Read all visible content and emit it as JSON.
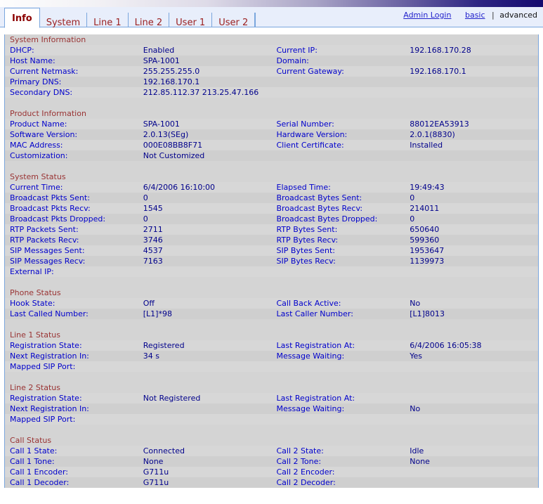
{
  "header": {
    "tabs": [
      {
        "label": "Info",
        "active": true
      },
      {
        "label": "System",
        "active": false
      },
      {
        "label": "Line 1",
        "active": false
      },
      {
        "label": "Line 2",
        "active": false
      },
      {
        "label": "User 1",
        "active": false
      },
      {
        "label": "User 2",
        "active": false
      }
    ],
    "admin_login": "Admin Login",
    "basic": "basic",
    "separator": "|",
    "advanced": "advanced"
  },
  "colors": {
    "section_heading": "#993333",
    "label": "#0000cc",
    "value": "#00008b",
    "tab_text": "#9a1f1f",
    "panel_bg": "#d4d4d4",
    "row_a": "#d7d7d7",
    "row_b": "#cfcfcf",
    "tab_border": "#7aa6dd"
  },
  "sections": [
    {
      "title": "System Information",
      "rows": [
        {
          "label": "DHCP:",
          "value": "Enabled",
          "label2": "Current IP:",
          "value2": "192.168.170.28"
        },
        {
          "label": "Host Name:",
          "value": "SPA-1001",
          "label2": "Domain:",
          "value2": ""
        },
        {
          "label": "Current Netmask:",
          "value": "255.255.255.0",
          "label2": "Current Gateway:",
          "value2": "192.168.170.1"
        },
        {
          "label": "Primary DNS:",
          "value": "192.168.170.1",
          "label2": "",
          "value2": ""
        },
        {
          "label": "Secondary DNS:",
          "value": "212.85.112.37 213.25.47.166",
          "label2": "",
          "value2": ""
        }
      ]
    },
    {
      "title": "Product Information",
      "rows": [
        {
          "label": "Product Name:",
          "value": "SPA-1001",
          "label2": "Serial Number:",
          "value2": "88012EA53913"
        },
        {
          "label": "Software Version:",
          "value": "2.0.13(SEg)",
          "label2": "Hardware Version:",
          "value2": "2.0.1(8830)"
        },
        {
          "label": "MAC Address:",
          "value": "000E08BB8F71",
          "label2": "Client Certificate:",
          "value2": "Installed"
        },
        {
          "label": "Customization:",
          "value": "Not Customized",
          "label2": "",
          "value2": ""
        }
      ]
    },
    {
      "title": "System Status",
      "rows": [
        {
          "label": "Current Time:",
          "value": "6/4/2006 16:10:00",
          "label2": "Elapsed Time:",
          "value2": "19:49:43"
        },
        {
          "label": "Broadcast Pkts Sent:",
          "value": "0",
          "label2": "Broadcast Bytes Sent:",
          "value2": "0"
        },
        {
          "label": "Broadcast Pkts Recv:",
          "value": "1545",
          "label2": "Broadcast Bytes Recv:",
          "value2": "214011"
        },
        {
          "label": "Broadcast Pkts Dropped:",
          "value": "0",
          "label2": "Broadcast Bytes Dropped:",
          "value2": "0"
        },
        {
          "label": "RTP Packets Sent:",
          "value": "2711",
          "label2": "RTP Bytes Sent:",
          "value2": "650640"
        },
        {
          "label": "RTP Packets Recv:",
          "value": "3746",
          "label2": "RTP Bytes Recv:",
          "value2": "599360"
        },
        {
          "label": "SIP Messages Sent:",
          "value": "4537",
          "label2": "SIP Bytes Sent:",
          "value2": "1953647"
        },
        {
          "label": "SIP Messages Recv:",
          "value": "7163",
          "label2": "SIP Bytes Recv:",
          "value2": "1139973"
        },
        {
          "label": "External IP:",
          "value": "",
          "label2": "",
          "value2": ""
        }
      ]
    },
    {
      "title": "Phone Status",
      "rows": [
        {
          "label": "Hook State:",
          "value": "Off",
          "label2": "Call Back Active:",
          "value2": "No"
        },
        {
          "label": "Last Called Number:",
          "value": "[L1]*98",
          "label2": "Last Caller Number:",
          "value2": "[L1]8013"
        }
      ]
    },
    {
      "title": "Line 1 Status",
      "rows": [
        {
          "label": "Registration State:",
          "value": "Registered",
          "label2": "Last Registration At:",
          "value2": "6/4/2006 16:05:38"
        },
        {
          "label": "Next Registration In:",
          "value": "34 s",
          "label2": "Message Waiting:",
          "value2": "Yes"
        },
        {
          "label": "Mapped SIP Port:",
          "value": "",
          "label2": "",
          "value2": ""
        }
      ]
    },
    {
      "title": "Line 2 Status",
      "rows": [
        {
          "label": "Registration State:",
          "value": "Not Registered",
          "label2": "Last Registration At:",
          "value2": ""
        },
        {
          "label": "Next Registration In:",
          "value": "",
          "label2": "Message Waiting:",
          "value2": "No"
        },
        {
          "label": "Mapped SIP Port:",
          "value": "",
          "label2": "",
          "value2": ""
        }
      ]
    },
    {
      "title": "Call Status",
      "rows": [
        {
          "label": "Call 1 State:",
          "value": "Connected",
          "label2": "Call 2 State:",
          "value2": "Idle"
        },
        {
          "label": "Call 1 Tone:",
          "value": "None",
          "label2": "Call 2 Tone:",
          "value2": "None"
        },
        {
          "label": "Call 1 Encoder:",
          "value": "G711u",
          "label2": "Call 2 Encoder:",
          "value2": ""
        },
        {
          "label": "Call 1 Decoder:",
          "value": "G711u",
          "label2": "Call 2 Decoder:",
          "value2": ""
        }
      ]
    }
  ]
}
